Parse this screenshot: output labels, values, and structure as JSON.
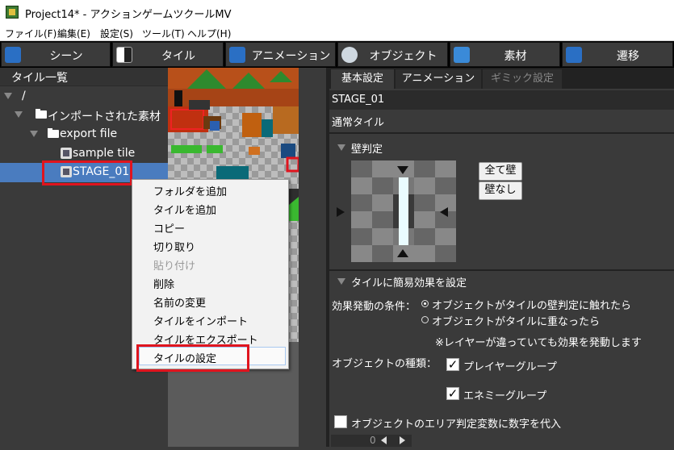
{
  "window": {
    "title": "Project14* - アクションゲームツクールMV"
  },
  "menubar": {
    "items": [
      "ファイル(F)",
      "編集(E)",
      "設定(S)",
      "ツール(T)",
      "ヘルプ(H)"
    ]
  },
  "main_tabs": [
    "シーン",
    "タイル",
    "アニメーション",
    "オブジェクト",
    "素材",
    "遷移"
  ],
  "tree": {
    "header": "タイル一覧",
    "root": "/",
    "folder_imported": "インポートされた素材",
    "folder_export": "export file",
    "item_sample": "sample tile",
    "item_stage": "STAGE_01"
  },
  "context_menu": {
    "items": [
      "フォルダを追加",
      "タイルを追加",
      "コピー",
      "切り取り",
      "貼り付け",
      "削除",
      "名前の変更",
      "タイルをインポート",
      "タイルをエクスポート",
      "タイルの設定"
    ]
  },
  "right_tabs": [
    "基本設定",
    "アニメーション",
    "ギミック設定"
  ],
  "tile_name": "STAGE_01",
  "tile_type": "通常タイル",
  "wall": {
    "section_title": "壁判定",
    "all_wall_button": "全て壁",
    "no_wall_button": "壁なし"
  },
  "effect": {
    "section_title": "タイルに簡易効果を設定",
    "condition_label": "効果発動の条件：",
    "radio_touch": "オブジェクトがタイルの壁判定に触れたら",
    "radio_overlap": "オブジェクトがタイルに重なったら",
    "note": "※レイヤーが違っていても効果を発動します",
    "object_type_label": "オブジェクトの種類：",
    "player_group": "プレイヤーグループ",
    "enemy_group": "エネミーグループ",
    "area_var_label": "オブジェクトのエリア判定変数に数字を代入",
    "spinner_value": "0"
  },
  "colors": {
    "selection": "#4a7cbf",
    "highlight_red": "#e0141e",
    "panel_bg": "#3a3a3a"
  }
}
